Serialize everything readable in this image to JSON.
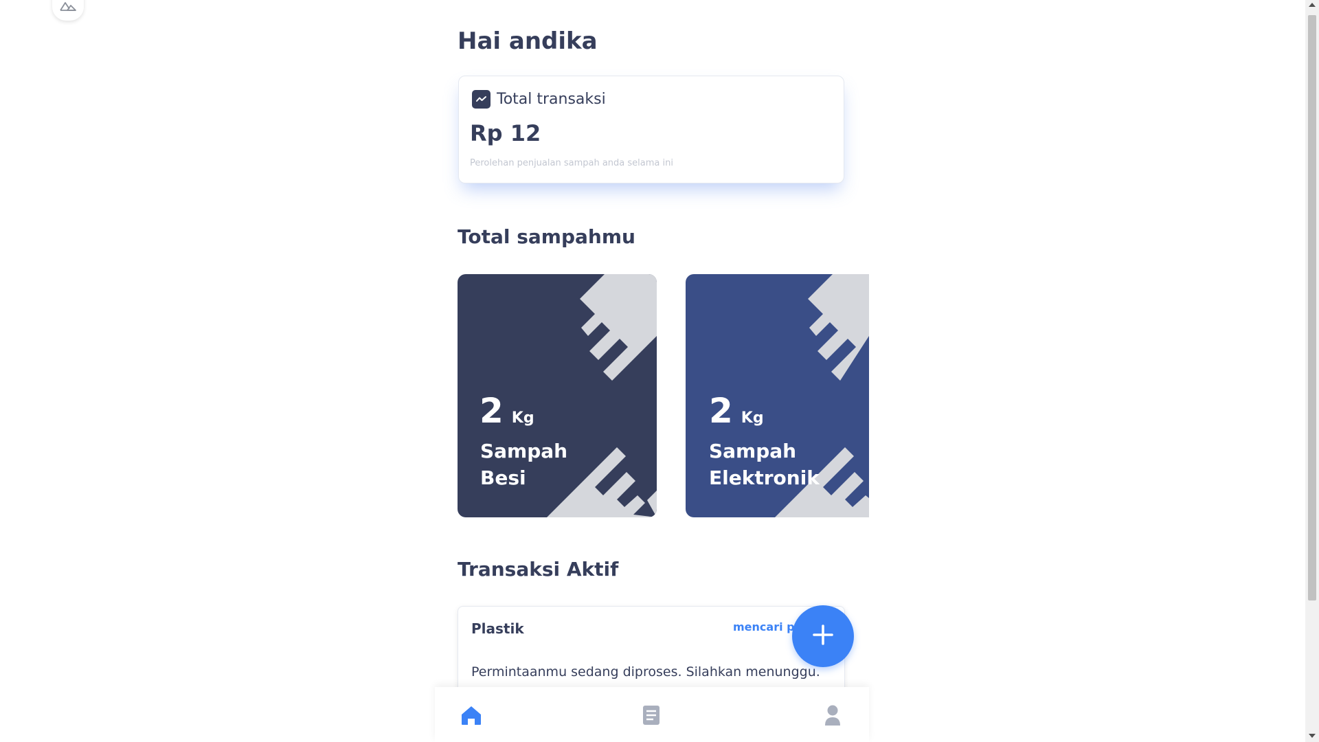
{
  "greeting": "Hai andika",
  "transaction_summary": {
    "title": "Total transaksi",
    "amount": "Rp 12",
    "caption": "Perolehan penjualan sampah anda selama ini"
  },
  "waste_section": {
    "title": "Total sampahmu",
    "cards": [
      {
        "amount": "2",
        "unit": "Kg",
        "line1": "Sampah",
        "line2": "Besi",
        "color": "#363e5b"
      },
      {
        "amount": "2",
        "unit": "Kg",
        "line1": "Sampah",
        "line2": "Elektronik",
        "color": "#3a4e87"
      }
    ]
  },
  "active_section": {
    "title": "Transaksi Aktif",
    "item": {
      "name": "Plastik",
      "status": "mencari pe",
      "message": "Permintaanmu sedang diproses. Silahkan menunggu."
    }
  },
  "icons": {
    "fab": "plus-icon",
    "nav": [
      "home-icon",
      "document-icon",
      "user-icon"
    ]
  },
  "colors": {
    "accent": "#3b82f6",
    "dark_navy": "#363e5b",
    "nav_inactive": "#a9afbd"
  }
}
